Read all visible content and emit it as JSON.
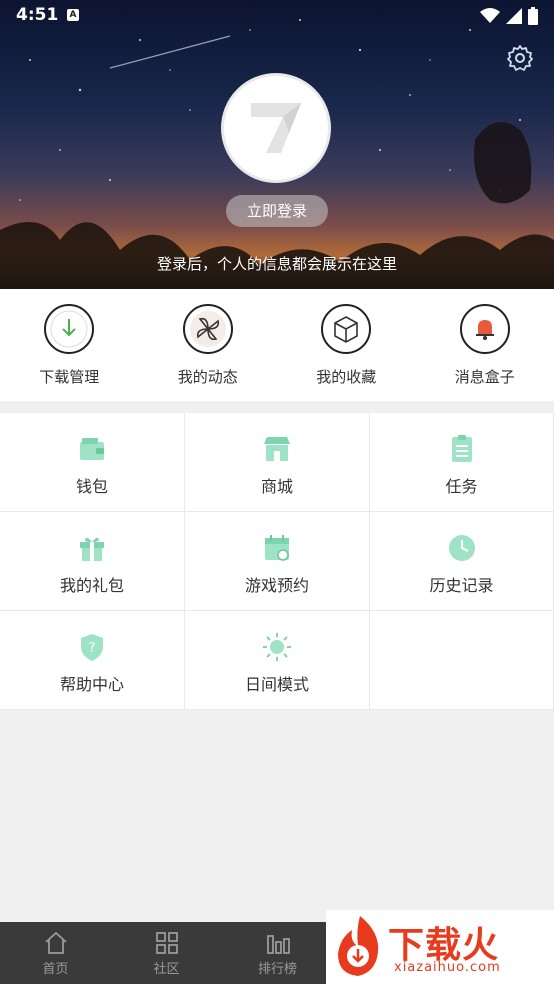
{
  "status_bar": {
    "time": "4:51",
    "notification_badge": "A"
  },
  "header": {
    "login_button": "立即登录",
    "login_hint": "登录后，个人的信息都会展示在这里"
  },
  "quick_actions": [
    {
      "label": "下载管理",
      "icon": "download-icon"
    },
    {
      "label": "我的动态",
      "icon": "pinwheel-icon"
    },
    {
      "label": "我的收藏",
      "icon": "box-icon"
    },
    {
      "label": "消息盒子",
      "icon": "bell-icon"
    }
  ],
  "grid": [
    {
      "label": "钱包",
      "icon": "wallet-icon"
    },
    {
      "label": "商城",
      "icon": "store-icon"
    },
    {
      "label": "任务",
      "icon": "clipboard-icon"
    },
    {
      "label": "我的礼包",
      "icon": "gift-icon"
    },
    {
      "label": "游戏预约",
      "icon": "calendar-icon"
    },
    {
      "label": "历史记录",
      "icon": "clock-icon"
    },
    {
      "label": "帮助中心",
      "icon": "help-shield-icon"
    },
    {
      "label": "日间模式",
      "icon": "sun-icon"
    }
  ],
  "bottom_nav": [
    {
      "label": "首页",
      "icon": "home-icon"
    },
    {
      "label": "社区",
      "icon": "grid-icon"
    },
    {
      "label": "排行榜",
      "icon": "ranking-icon"
    }
  ],
  "watermark": {
    "text": "下载火",
    "url": "xiazaihuo.com"
  },
  "colors": {
    "accent_green": "#7fd4b0",
    "nav_bg": "#3a3a3a",
    "watermark_red": "#e83a1c"
  }
}
